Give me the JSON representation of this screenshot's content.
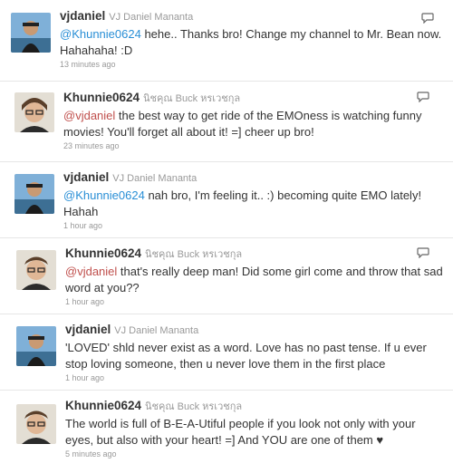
{
  "tweets": [
    {
      "screen_name": "vjdaniel",
      "full_name": "VJ Daniel Mananta",
      "mention": "@Khunnie0624",
      "body": " hehe.. Thanks bro! Change my channel to Mr. Bean now. Hahahaha! :D",
      "time": "13 minutes ago",
      "avatar": "person-avatar-blue"
    },
    {
      "screen_name": "Khunnie0624",
      "full_name": "นิชคุณ Buck หรเวชกุล",
      "mention": "@vjdaniel",
      "body": " the best way to get ride of the EMOness is watching funny movies! You'll forget all about it! =] cheer up bro!",
      "time": "23 minutes ago",
      "avatar": "person-avatar-glasses"
    },
    {
      "screen_name": "vjdaniel",
      "full_name": "VJ Daniel Mananta",
      "mention": "@Khunnie0624",
      "body": " nah bro, I'm feeling it.. :) becoming quite EMO lately! Hahah",
      "time": "1 hour ago",
      "avatar": "person-avatar-blue"
    },
    {
      "screen_name": "Khunnie0624",
      "full_name": "นิชคุณ Buck หรเวชกุล",
      "mention": "@vjdaniel",
      "body": " that's really deep man! Did some girl come and throw that sad word at you??",
      "time": "1 hour ago",
      "avatar": "person-avatar-glasses"
    },
    {
      "screen_name": "vjdaniel",
      "full_name": "VJ Daniel Mananta",
      "mention": "",
      "body": "'LOVED' shld never exist as a word. Love has no past tense. If u ever stop loving someone, then u never love them in the first place",
      "time": "1 hour ago",
      "avatar": "person-avatar-blue"
    },
    {
      "screen_name": "Khunnie0624",
      "full_name": "นิชคุณ Buck หรเวชกุล",
      "mention": "",
      "body": "The world is full of B-E-A-Utiful people if you look not only with your eyes, but also with your heart! =] And YOU are one of them ♥",
      "time": "5 minutes ago",
      "avatar": "person-avatar-glasses"
    }
  ]
}
